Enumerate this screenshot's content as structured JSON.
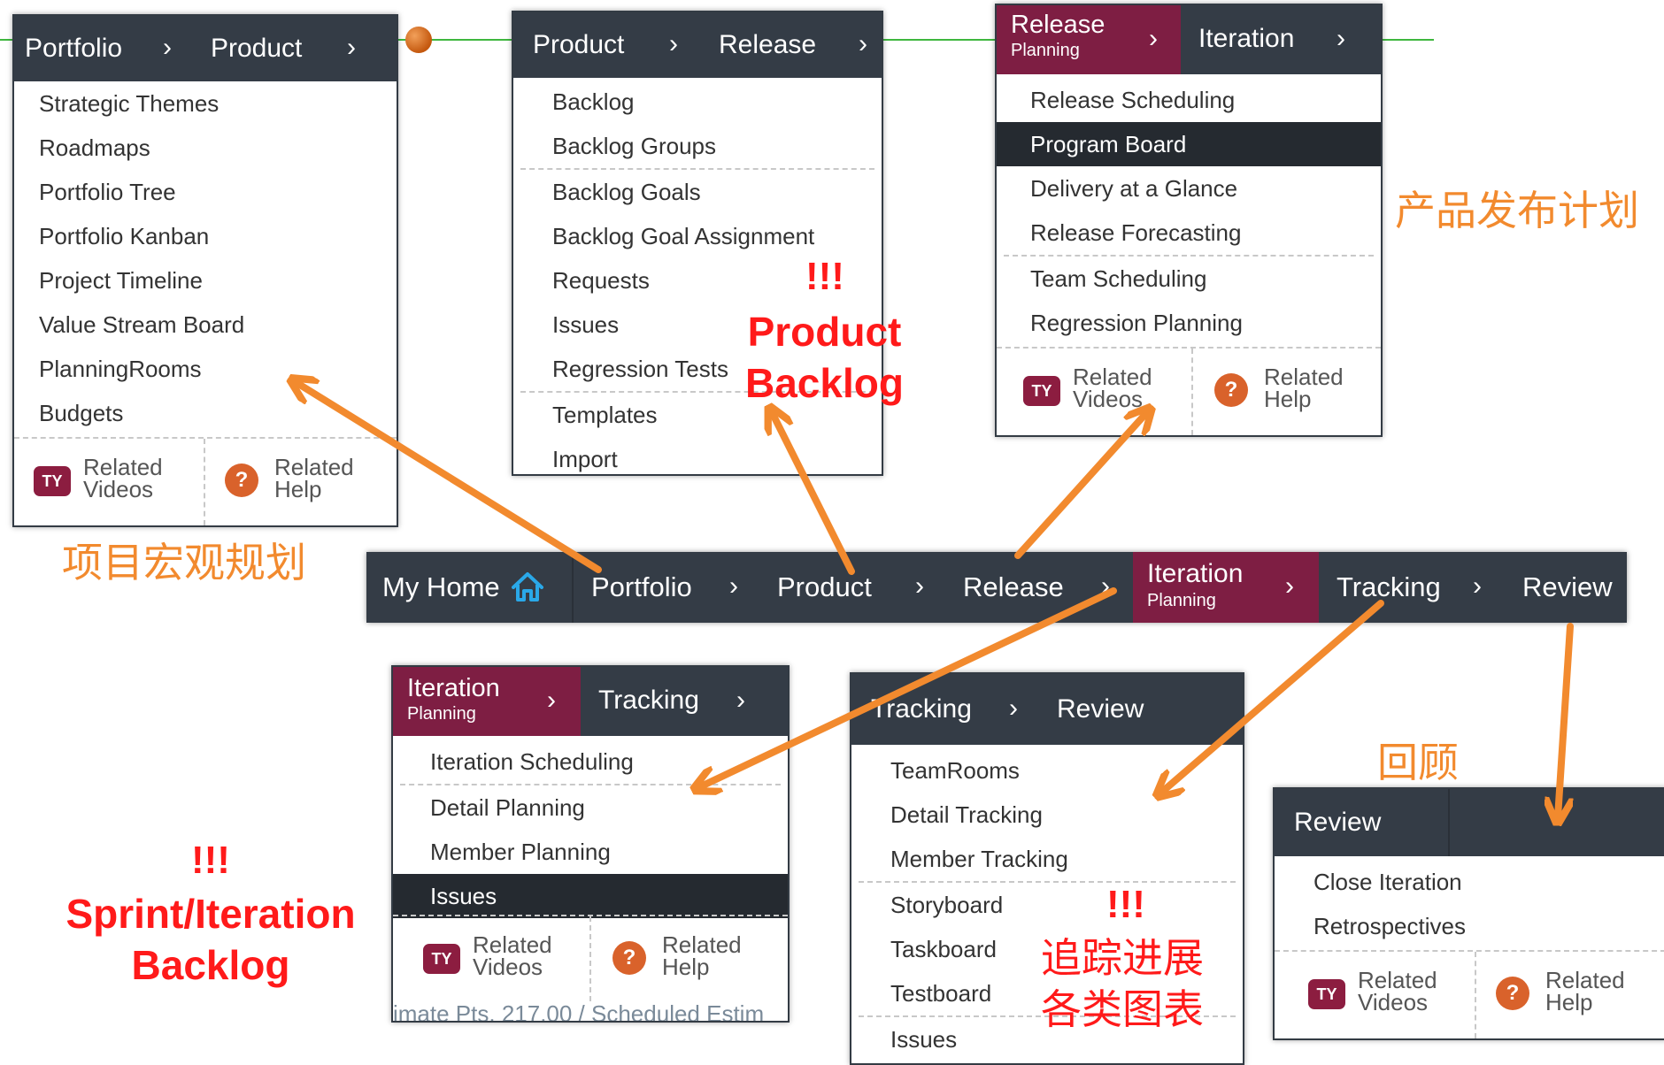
{
  "colors": {
    "nav_bar": "#343c46",
    "highlight": "#7e1e43",
    "arrow": "#f28a2e",
    "alert_red": "#ff1a1a",
    "annotation_orange": "#f28a2e",
    "connector": "#3fb73f"
  },
  "main_nav": {
    "home": "My Home",
    "home_icon": "home-icon",
    "items": [
      "Portfolio",
      "Product",
      "Release",
      "Tracking",
      "Review"
    ],
    "iteration": {
      "title": "Iteration",
      "subtitle": "Planning"
    },
    "chevron": "›"
  },
  "portfolio_panel": {
    "crumbs": [
      "Portfolio",
      "Product"
    ],
    "items": [
      "Strategic Themes",
      "Roadmaps",
      "Portfolio Tree",
      "Portfolio Kanban",
      "Project Timeline",
      "Value Stream Board",
      "PlanningRooms",
      "Budgets"
    ]
  },
  "product_panel": {
    "crumbs": [
      "Product",
      "Release"
    ],
    "items": [
      "Backlog",
      "Backlog Groups",
      "Backlog Goals",
      "Backlog Goal Assignment",
      "Requests",
      "Issues",
      "Regression Tests",
      "Templates",
      "Import"
    ]
  },
  "release_panel": {
    "highlight": {
      "title": "Release",
      "subtitle": "Planning"
    },
    "next": "Iteration",
    "items": [
      "Release Scheduling",
      "Program Board",
      "Delivery at a Glance",
      "Release Forecasting",
      "Team Scheduling",
      "Regression Planning"
    ],
    "selected": "Program Board"
  },
  "iteration_panel": {
    "highlight": {
      "title": "Iteration",
      "subtitle": "Planning"
    },
    "next": "Tracking",
    "items": [
      "Iteration Scheduling",
      "Detail Planning",
      "Member Planning",
      "Issues"
    ],
    "selected": "Issues",
    "bottom_peek": "imate Pts. 217.00 / Scheduled Estim"
  },
  "tracking_panel": {
    "crumbs": [
      "Tracking",
      "Review"
    ],
    "items": [
      "TeamRooms",
      "Detail Tracking",
      "Member Tracking",
      "Storyboard",
      "Taskboard",
      "Testboard",
      "Issues"
    ]
  },
  "review_panel": {
    "crumbs": [
      "Review"
    ],
    "items": [
      "Close Iteration",
      "Retrospectives"
    ]
  },
  "footer": {
    "videos_line1": "Related",
    "videos_line2": "Videos",
    "help_line1": "Related",
    "help_line2": "Help",
    "videos_icon": "TY",
    "help_icon": "?"
  },
  "annotations": {
    "portfolio_cn": "项目宏观规划",
    "release_cn": "产品发布计划",
    "review_cn": "回顾",
    "tracking_cn_line1": "追踪进展",
    "tracking_cn_line2": "各类图表",
    "product_alert": "!!!",
    "product_line1": "Product",
    "product_line2": "Backlog",
    "sprint_alert": "!!!",
    "sprint_line1": "Sprint/Iteration",
    "sprint_line2": "Backlog",
    "tracking_alert": "!!!"
  }
}
